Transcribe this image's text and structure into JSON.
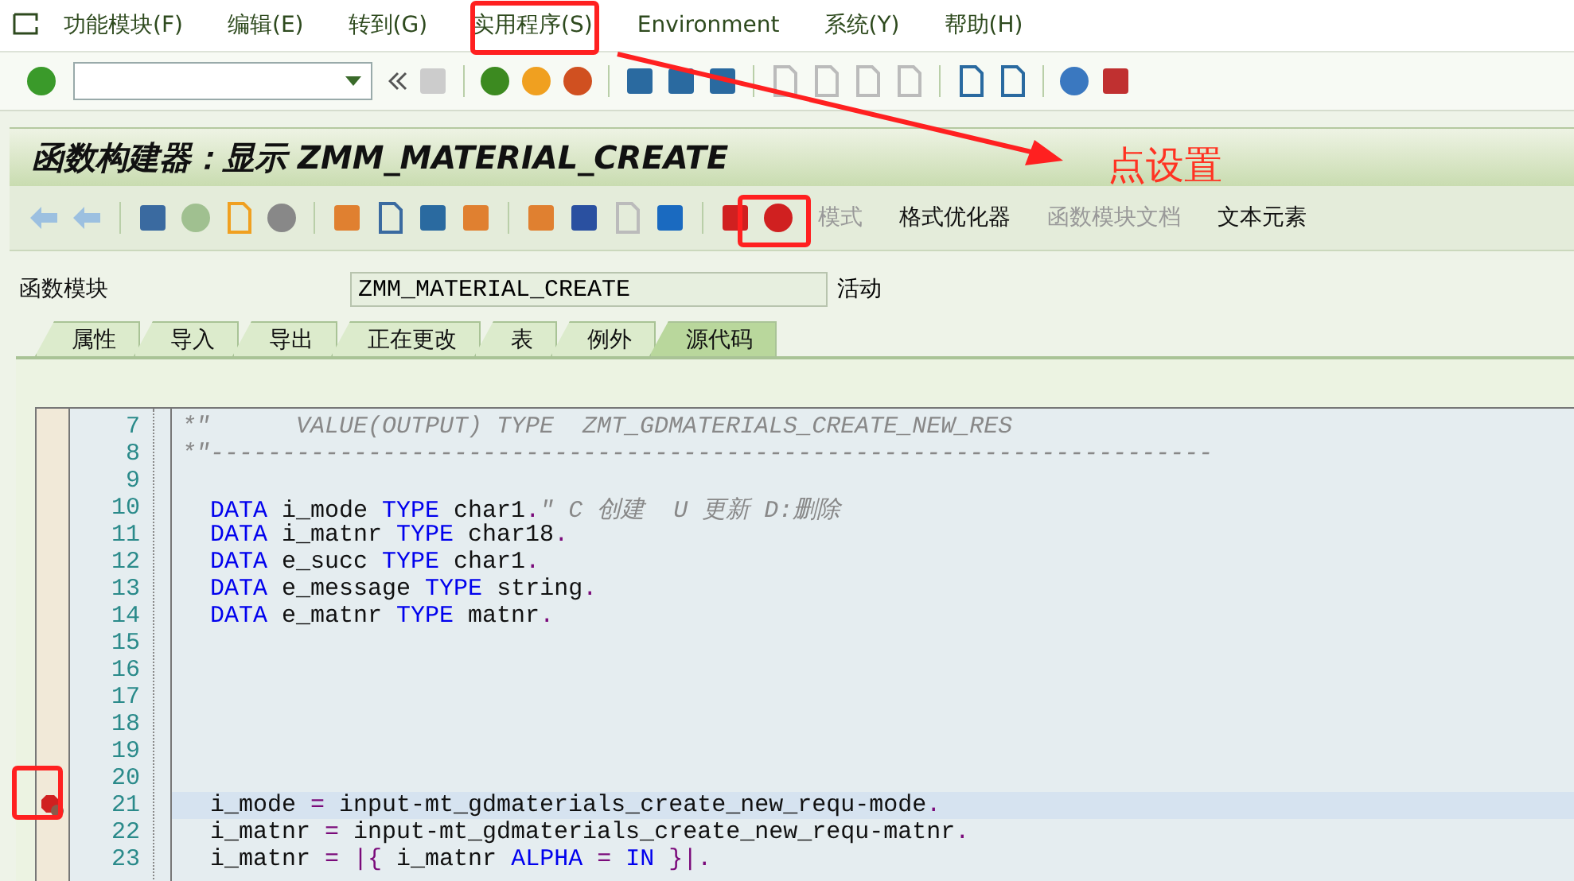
{
  "menu": [
    {
      "label": "功能模块(F)"
    },
    {
      "label": "编辑(E)"
    },
    {
      "label": "转到(G)"
    },
    {
      "label": "实用程序(S)"
    },
    {
      "label": "Environment"
    },
    {
      "label": "系统(Y)"
    },
    {
      "label": "帮助(H)"
    }
  ],
  "title": "函数构建器：显示 ",
  "title_name": "ZMM_MATERIAL_CREATE",
  "app_toolbar": [
    {
      "label": "模式",
      "disabled": true
    },
    {
      "label": "格式优化器",
      "disabled": false
    },
    {
      "label": "函数模块文档",
      "disabled": true
    },
    {
      "label": "文本元素",
      "disabled": false
    }
  ],
  "field": {
    "label": "函数模块",
    "value": "ZMM_MATERIAL_CREATE",
    "status": "活动"
  },
  "tabs": [
    {
      "label": "属性",
      "selected": false
    },
    {
      "label": "导入",
      "selected": false
    },
    {
      "label": "导出",
      "selected": false
    },
    {
      "label": "正在更改",
      "selected": false
    },
    {
      "label": "表",
      "selected": false
    },
    {
      "label": "例外",
      "selected": false
    },
    {
      "label": "源代码",
      "selected": true
    }
  ],
  "code": [
    {
      "number": "7",
      "highlighted": false,
      "breakpoint": false,
      "tokens": [
        {
          "kind": "comment",
          "text": "*\"      VALUE(OUTPUT) TYPE  ZMT_GDMATERIALS_CREATE_NEW_RES"
        }
      ]
    },
    {
      "number": "8",
      "highlighted": false,
      "breakpoint": false,
      "tokens": [
        {
          "kind": "comment",
          "text": "*\"----------------------------------------------------------------------"
        }
      ]
    },
    {
      "number": "9",
      "highlighted": false,
      "breakpoint": false
    },
    {
      "number": "10",
      "highlighted": false,
      "breakpoint": false,
      "tokens": [
        {
          "kind": "keyword",
          "text": "  DATA"
        },
        {
          "kind": "plain",
          "text": " i_mode "
        },
        {
          "kind": "keyword",
          "text": "TYPE"
        },
        {
          "kind": "plain",
          "text": " char1"
        },
        {
          "kind": "op",
          "text": "."
        },
        {
          "kind": "comment",
          "text": "\" C 创建  U 更新 D:删除"
        }
      ]
    },
    {
      "number": "11",
      "highlighted": false,
      "breakpoint": false,
      "tokens": [
        {
          "kind": "keyword",
          "text": "  DATA"
        },
        {
          "kind": "plain",
          "text": " i_matnr "
        },
        {
          "kind": "keyword",
          "text": "TYPE"
        },
        {
          "kind": "plain",
          "text": " char18"
        },
        {
          "kind": "op",
          "text": "."
        }
      ]
    },
    {
      "number": "12",
      "highlighted": false,
      "breakpoint": false,
      "tokens": [
        {
          "kind": "keyword",
          "text": "  DATA"
        },
        {
          "kind": "plain",
          "text": " e_succ "
        },
        {
          "kind": "keyword",
          "text": "TYPE"
        },
        {
          "kind": "plain",
          "text": " char1"
        },
        {
          "kind": "op",
          "text": "."
        }
      ]
    },
    {
      "number": "13",
      "highlighted": false,
      "breakpoint": false,
      "tokens": [
        {
          "kind": "keyword",
          "text": "  DATA"
        },
        {
          "kind": "plain",
          "text": " e_message "
        },
        {
          "kind": "keyword",
          "text": "TYPE"
        },
        {
          "kind": "plain",
          "text": " string"
        },
        {
          "kind": "op",
          "text": "."
        }
      ]
    },
    {
      "number": "14",
      "highlighted": false,
      "breakpoint": false,
      "tokens": [
        {
          "kind": "keyword",
          "text": "  DATA"
        },
        {
          "kind": "plain",
          "text": " e_matnr "
        },
        {
          "kind": "keyword",
          "text": "TYPE"
        },
        {
          "kind": "plain",
          "text": " matnr"
        },
        {
          "kind": "op",
          "text": "."
        }
      ]
    },
    {
      "number": "15",
      "highlighted": false,
      "breakpoint": false
    },
    {
      "number": "16",
      "highlighted": false,
      "breakpoint": false
    },
    {
      "number": "17",
      "highlighted": false,
      "breakpoint": false
    },
    {
      "number": "18",
      "highlighted": false,
      "breakpoint": false
    },
    {
      "number": "19",
      "highlighted": false,
      "breakpoint": false
    },
    {
      "number": "20",
      "highlighted": false,
      "breakpoint": false
    },
    {
      "number": "21",
      "highlighted": true,
      "breakpoint": true,
      "tokens": [
        {
          "kind": "plain",
          "text": "  i_mode "
        },
        {
          "kind": "op",
          "text": "="
        },
        {
          "kind": "plain",
          "text": " input-mt_gdmaterials_create_new_requ-mode"
        },
        {
          "kind": "op",
          "text": "."
        }
      ]
    },
    {
      "number": "22",
      "highlighted": false,
      "breakpoint": false,
      "tokens": [
        {
          "kind": "plain",
          "text": "  i_matnr "
        },
        {
          "kind": "op",
          "text": "="
        },
        {
          "kind": "plain",
          "text": " input-mt_gdmaterials_create_new_requ-matnr"
        },
        {
          "kind": "op",
          "text": "."
        }
      ]
    },
    {
      "number": "23",
      "highlighted": false,
      "breakpoint": false,
      "tokens": [
        {
          "kind": "plain",
          "text": "  i_matnr "
        },
        {
          "kind": "op",
          "text": "="
        },
        {
          "kind": "op",
          "text": " |{"
        },
        {
          "kind": "plain",
          "text": " i_matnr "
        },
        {
          "kind": "keyword",
          "text": "ALPHA"
        },
        {
          "kind": "op",
          "text": " ="
        },
        {
          "kind": "keyword",
          "text": " IN"
        },
        {
          "kind": "op",
          "text": " }|."
        }
      ]
    }
  ],
  "annotation": {
    "text": "点设置"
  }
}
